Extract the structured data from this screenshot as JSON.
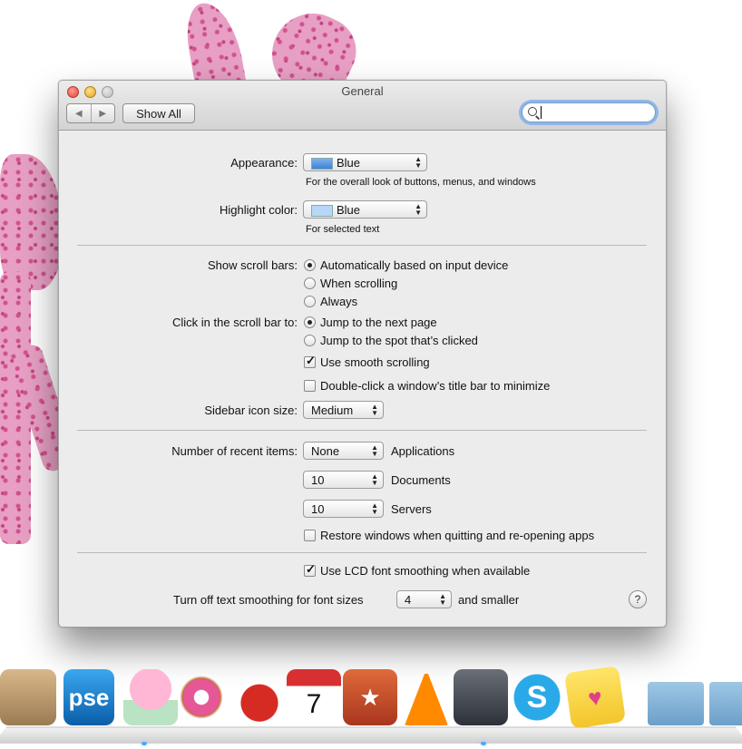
{
  "window": {
    "title": "General",
    "show_all_label": "Show All",
    "search": {
      "placeholder": "",
      "value": ""
    }
  },
  "appearance": {
    "label": "Appearance:",
    "value": "Blue",
    "hint": "For the overall look of buttons, menus, and windows"
  },
  "highlight": {
    "label": "Highlight color:",
    "value": "Blue",
    "hint": "For selected text"
  },
  "scroll_bars": {
    "label": "Show scroll bars:",
    "options": [
      {
        "label": "Automatically based on input device",
        "selected": true
      },
      {
        "label": "When scrolling",
        "selected": false
      },
      {
        "label": "Always",
        "selected": false
      }
    ]
  },
  "click_scroll": {
    "label": "Click in the scroll bar to:",
    "options": [
      {
        "label": "Jump to the next page",
        "selected": true
      },
      {
        "label": "Jump to the spot that’s clicked",
        "selected": false
      }
    ]
  },
  "smooth_scrolling": {
    "label": "Use smooth scrolling",
    "checked": true
  },
  "double_click": {
    "label": "Double-click a window’s title bar to minimize",
    "checked": false
  },
  "sidebar_icon": {
    "label": "Sidebar icon size:",
    "value": "Medium"
  },
  "recent_items": {
    "label": "Number of recent items:",
    "rows": [
      {
        "value": "None",
        "caption": "Applications"
      },
      {
        "value": "10",
        "caption": "Documents"
      },
      {
        "value": "10",
        "caption": "Servers"
      }
    ]
  },
  "restore_windows": {
    "label": "Restore windows when quitting and re-opening apps",
    "checked": false
  },
  "lcd_smoothing": {
    "label": "Use LCD font smoothing when available",
    "checked": true
  },
  "text_smoothing": {
    "prefix": "Turn off text smoothing for font sizes",
    "value": "4",
    "suffix": "and smaller"
  },
  "help_label": "?",
  "dock": {
    "pse_label": "pse",
    "calendar_day": "7",
    "skype_label": "S",
    "notes_glyph": "♥",
    "reeder_glyph": "★"
  },
  "colors": {
    "blue_swatch": "#4a8fde",
    "highlight_swatch": "#b7d7f7",
    "desktop_pink": "#e7a0c3"
  }
}
